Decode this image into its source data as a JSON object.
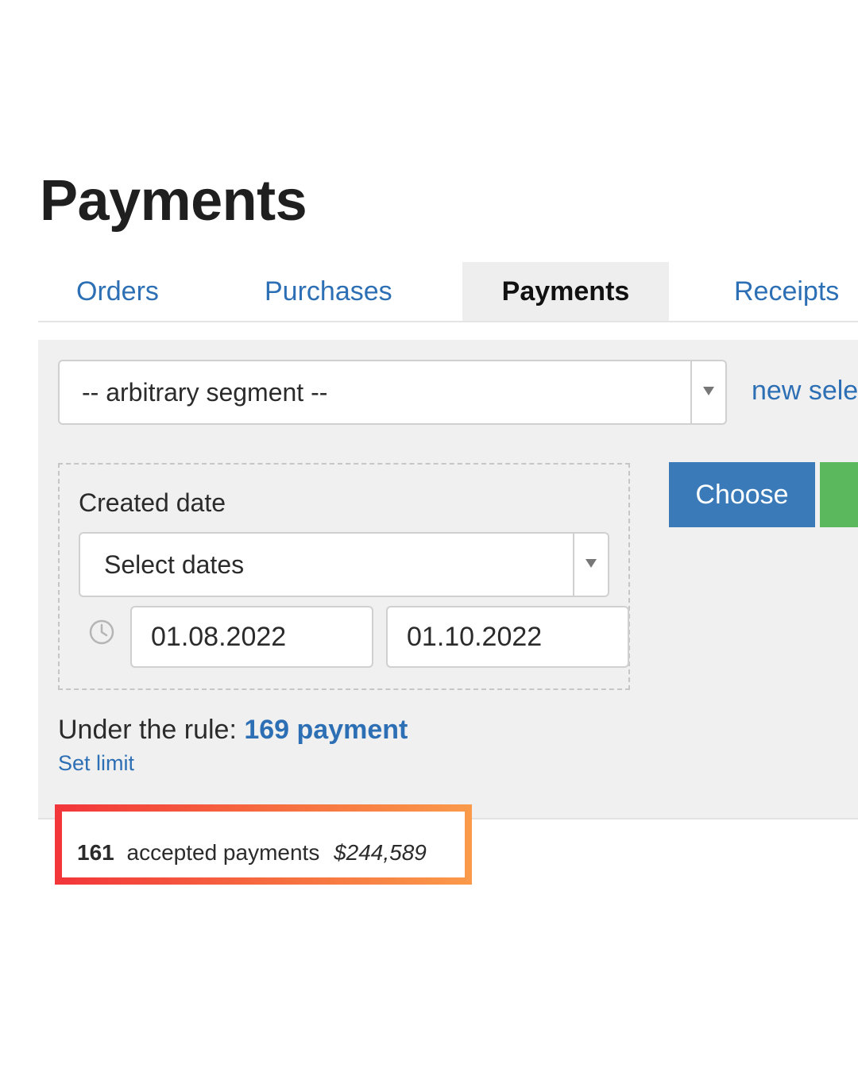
{
  "header": {
    "title": "Payments"
  },
  "tabs": [
    {
      "label": "Orders",
      "active": false
    },
    {
      "label": "Purchases",
      "active": false
    },
    {
      "label": "Payments",
      "active": true
    },
    {
      "label": "Receipts",
      "active": false
    }
  ],
  "filter": {
    "segment_value": "-- arbitrary segment --",
    "new_selection_link": "new sele",
    "rule": {
      "label": "Created date",
      "dates_select_value": "Select dates",
      "date_from": "01.08.2022",
      "date_to": "01.10.2022"
    },
    "choose_label": "Choose",
    "summary_prefix": "Under the rule:",
    "summary_count": "169 payment",
    "set_limit_label": "Set limit"
  },
  "result": {
    "count": "161",
    "label": "accepted payments",
    "amount": "$244,589"
  },
  "colors": {
    "link": "#2d6fb5",
    "choose_button": "#3a7ab8",
    "green_button": "#5cb85c",
    "panel_background": "#f0f0f0",
    "highlight_gradient": [
      "#f2353a",
      "#fa9a4a"
    ]
  },
  "icons": {
    "dates_clock": "clock-icon",
    "select_arrow": "chevron-down-icon"
  }
}
